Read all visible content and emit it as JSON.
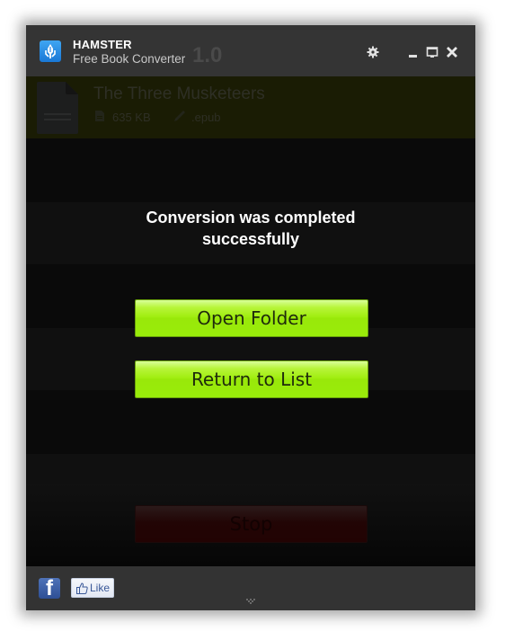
{
  "window": {
    "app_name": "HAMSTER",
    "app_subtitle": "Free Book Converter",
    "version": "1.0",
    "controls": {
      "settings": "gear-icon",
      "minimize": "minimize-icon",
      "restore": "restore-icon",
      "close": "close-icon"
    }
  },
  "book": {
    "title": "The Three Musketeers",
    "size": "635 KB",
    "format": ".epub"
  },
  "overlay": {
    "message_line1": "Conversion was completed",
    "message_line2": "successfully",
    "open_folder_label": "Open Folder",
    "return_label": "Return to List"
  },
  "stop_label": "Stop",
  "footer": {
    "facebook": "f",
    "like_label": "Like"
  },
  "colors": {
    "accent_green": "#99e80a",
    "titlebar": "#343434",
    "facebook_blue": "#3b5998"
  }
}
